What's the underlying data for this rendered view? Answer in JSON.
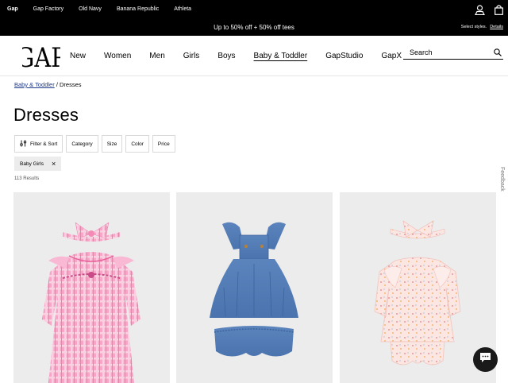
{
  "topbar": {
    "brands": [
      "Gap",
      "Gap Factory",
      "Old Navy",
      "Banana Republic",
      "Athleta"
    ],
    "promo": "Up to 50% off + 50% off tees",
    "promo_note": "Select styles.",
    "promo_details": "Details"
  },
  "nav": {
    "logo": "GAP",
    "items": [
      "New",
      "Women",
      "Men",
      "Girls",
      "Boys",
      "Baby & Toddler",
      "GapStudio",
      "GapX"
    ],
    "current": "Baby & Toddler",
    "search_placeholder": "Search"
  },
  "breadcrumb": {
    "parent": "Baby & Toddler",
    "separator": "/",
    "current": "Dresses"
  },
  "page_title": "Dresses",
  "filters": [
    "Filter & Sort",
    "Category",
    "Size",
    "Color",
    "Price"
  ],
  "active_filter": "Baby Girls",
  "results_count": "113 Results",
  "feedback": "Feedback",
  "colors": {
    "topbar": "#000000",
    "card_bg": "#ececec",
    "link": "#1e3a8a"
  }
}
